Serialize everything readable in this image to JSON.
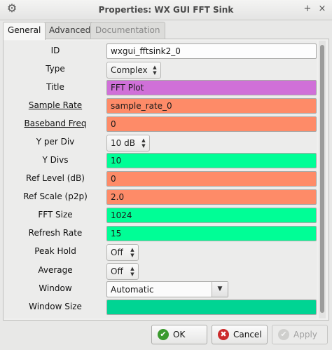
{
  "window": {
    "title": "Properties: WX GUI FFT Sink",
    "menu_icon": "gear-icon",
    "pin_symbol": "+",
    "close_symbol": "×"
  },
  "tabs": [
    {
      "label": "General"
    },
    {
      "label": "Advanced"
    },
    {
      "label": "Documentation"
    }
  ],
  "params": [
    {
      "label": "ID",
      "value": "wxgui_fftsink2_0",
      "kind": "entry",
      "color": "#fdfdfd"
    },
    {
      "label": "Type",
      "value": "Complex",
      "kind": "spin"
    },
    {
      "label": "Title",
      "value": "FFT Plot",
      "kind": "entry",
      "color": "#d070d8"
    },
    {
      "label": "Sample Rate",
      "value": "sample_rate_0",
      "kind": "entry",
      "color": "#fe8b68",
      "underline": true
    },
    {
      "label": "Baseband Freq",
      "value": "0",
      "kind": "entry",
      "color": "#fe8b68",
      "underline": true
    },
    {
      "label": "Y per Div",
      "value": "10 dB",
      "kind": "spin"
    },
    {
      "label": "Y Divs",
      "value": "10",
      "kind": "entry",
      "color": "#00fe96"
    },
    {
      "label": "Ref Level (dB)",
      "value": "0",
      "kind": "entry",
      "color": "#fe8b68"
    },
    {
      "label": "Ref Scale (p2p)",
      "value": "2.0",
      "kind": "entry",
      "color": "#fe8b68"
    },
    {
      "label": "FFT Size",
      "value": "1024",
      "kind": "entry",
      "color": "#00fe96"
    },
    {
      "label": "Refresh Rate",
      "value": "15",
      "kind": "entry",
      "color": "#00fe96"
    },
    {
      "label": "Peak Hold",
      "value": "Off",
      "kind": "spin"
    },
    {
      "label": "Average",
      "value": "Off",
      "kind": "spin"
    },
    {
      "label": "Window",
      "value": "Automatic",
      "kind": "combo"
    },
    {
      "label": "Window Size",
      "value": "",
      "kind": "entry",
      "color": "#00d493"
    }
  ],
  "buttons": {
    "ok": "OK",
    "cancel": "Cancel",
    "apply": "Apply"
  }
}
